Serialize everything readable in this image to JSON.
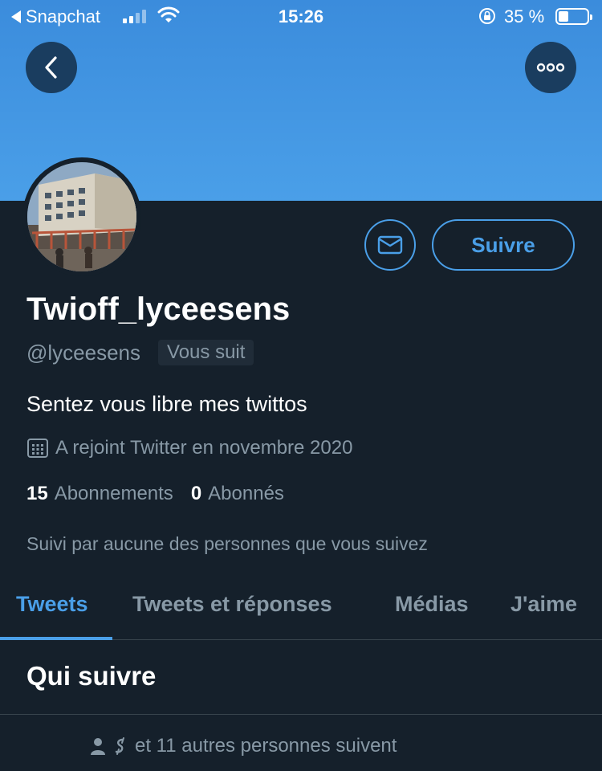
{
  "status_bar": {
    "back_app": "Snapchat",
    "time": "15:26",
    "battery": "35 %",
    "battery_level": 0.35,
    "icons": [
      "back-triangle-icon",
      "signal-icon",
      "wifi-icon",
      "rotation-lock-icon",
      "battery-icon"
    ]
  },
  "colors": {
    "banner": "#4a9fe8",
    "background": "#15202b",
    "accent": "#4a9fe8",
    "secondary_text": "#8899a6"
  },
  "header": {
    "back_icon": "chevron-left-icon",
    "more_icon": "more-dots-icon"
  },
  "profile": {
    "name": "Twioff_lyceesens",
    "handle": "@lyceesens",
    "follows_you": "Vous suit",
    "bio": "Sentez vous libre mes twittos",
    "joined": "A rejoint Twitter en novembre 2020",
    "following_count": "15",
    "following_label": "Abonnements",
    "followers_count": "0",
    "followers_label": "Abonnés",
    "followed_by": "Suivi par aucune des personnes que vous suivez"
  },
  "actions": {
    "message_icon": "envelope-icon",
    "follow_label": "Suivre"
  },
  "tabs": [
    {
      "label": "Tweets",
      "active": true
    },
    {
      "label": "Tweets et réponses",
      "active": false
    },
    {
      "label": "Médias",
      "active": false
    },
    {
      "label": "J'aime",
      "active": false
    }
  ],
  "who_to_follow": {
    "title": "Qui suivre",
    "suggestion_text": "et 11 autres personnes suivent"
  }
}
